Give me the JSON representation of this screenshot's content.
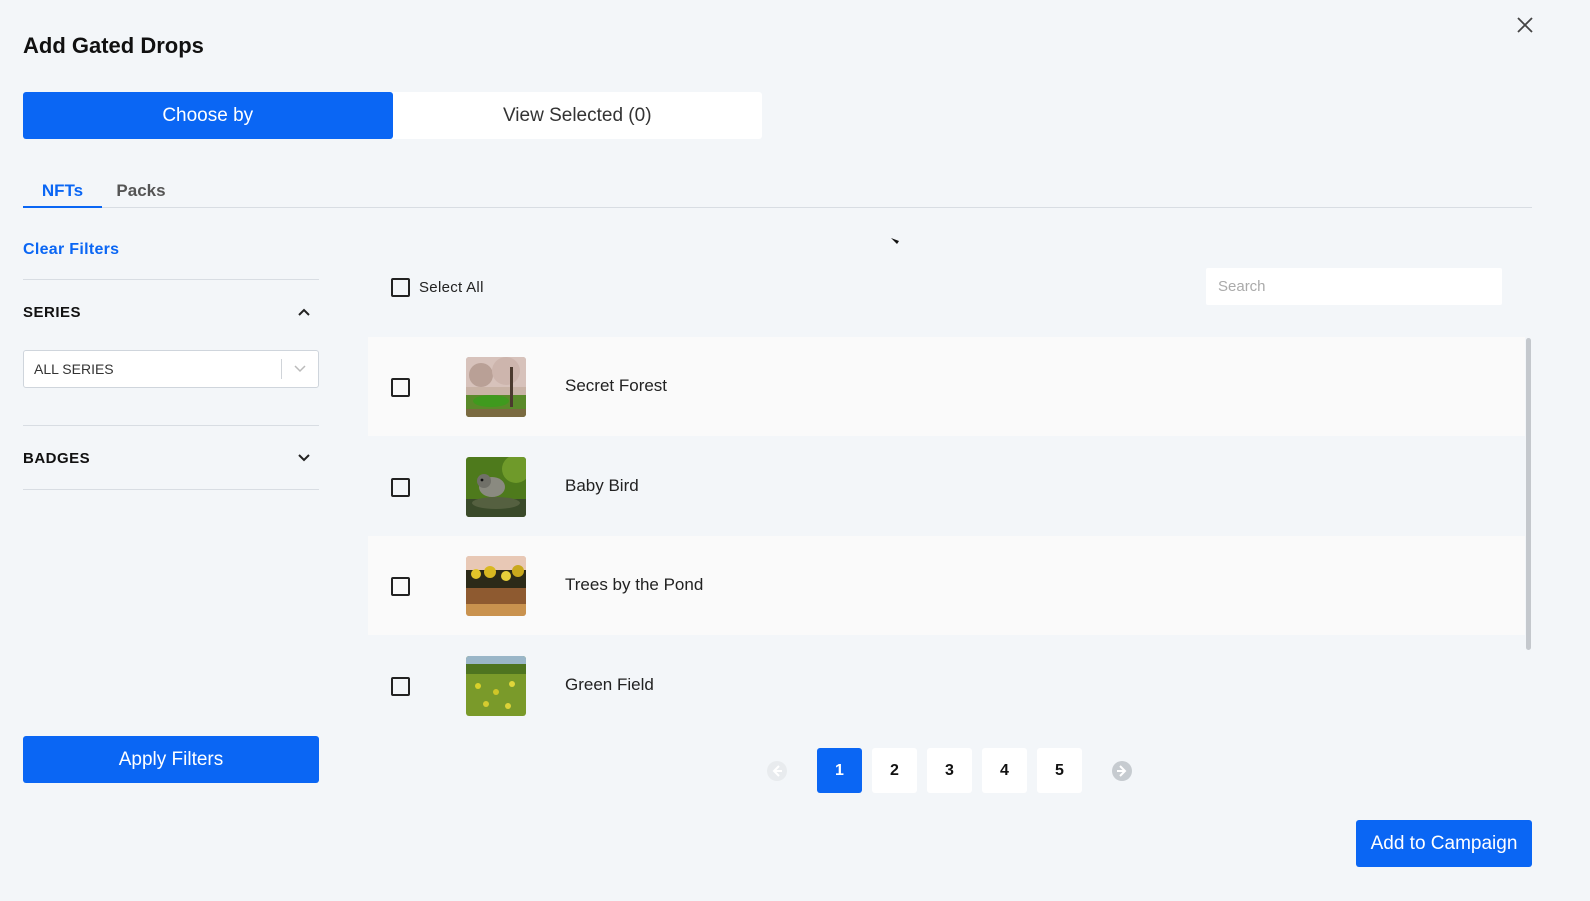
{
  "modal": {
    "title": "Add Gated Drops"
  },
  "segment": {
    "choose_by": "Choose by",
    "view_selected": "View Selected (0)"
  },
  "tabs": [
    {
      "label": "NFTs",
      "active": true
    },
    {
      "label": "Packs",
      "active": false
    }
  ],
  "filters": {
    "clear_label": "Clear Filters",
    "series": {
      "label": "SERIES",
      "expanded": true,
      "selected": "ALL SERIES"
    },
    "badges": {
      "label": "BADGES",
      "expanded": false
    },
    "apply_label": "Apply Filters"
  },
  "list": {
    "select_all_label": "Select All",
    "search_placeholder": "Search",
    "items": [
      {
        "name": "Secret Forest",
        "icon": "forest-thumbnail",
        "checked": false
      },
      {
        "name": "Baby Bird",
        "icon": "bird-thumbnail",
        "checked": false
      },
      {
        "name": "Trees by the Pond",
        "icon": "pond-thumbnail",
        "checked": false
      },
      {
        "name": "Green Field",
        "icon": "field-thumbnail",
        "checked": false
      }
    ]
  },
  "pagination": {
    "pages": [
      "1",
      "2",
      "3",
      "4",
      "5"
    ],
    "current": "1"
  },
  "footer": {
    "add_label": "Add to Campaign"
  },
  "colors": {
    "accent": "#0a66f4",
    "background": "#f3f6f9"
  }
}
